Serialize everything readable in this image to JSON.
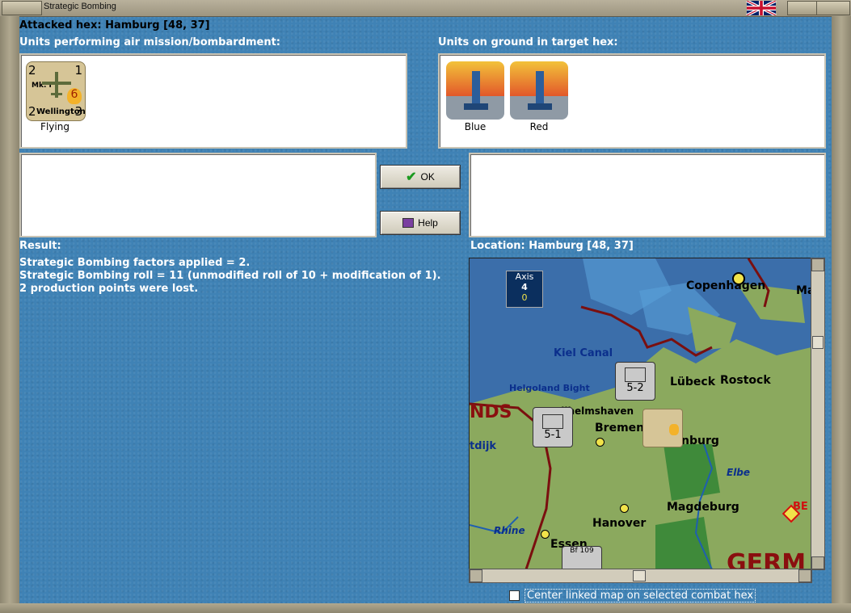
{
  "window": {
    "title": "Strategic Bombing"
  },
  "attacked_hex": "Attacked hex: Hamburg  [48, 37]",
  "air_units": {
    "heading": "Units performing air mission/bombardment:",
    "units": [
      {
        "label": "Flying",
        "counter_name": "Wellington",
        "model": "Mk. I",
        "top_left": "2",
        "top_right": "1",
        "bottom_left": "2",
        "bottom_right": "3",
        "badge": "6"
      }
    ]
  },
  "ground_units": {
    "heading": "Units on ground in target hex:",
    "units": [
      {
        "label": "Blue"
      },
      {
        "label": "Red"
      }
    ]
  },
  "buttons": {
    "ok": "OK",
    "help": "Help"
  },
  "result": {
    "heading": "Result:",
    "lines": [
      "Strategic Bombing factors applied = 2.",
      "Strategic Bombing roll = 11 (unmodified roll of 10 + modification of 1).",
      "2 production points were lost."
    ]
  },
  "location": {
    "heading": "Location:  Hamburg  [48, 37]",
    "map_labels": {
      "copenhagen": "Copenhagen",
      "ma": "Ma",
      "kiel_canal": "Kiel Canal",
      "lubeck": "Lübeck",
      "rostock": "Rostock",
      "helgoland": "Helgoland Bight",
      "wilhelmshaven": "Wilhelmshaven",
      "bremen": "Bremen",
      "hamburg": "nburg",
      "nds": "NDS",
      "tdijk": "tdijk",
      "elbe": "Elbe",
      "magdeburg": "Magdeburg",
      "hanover": "Hanover",
      "rhine": "Rhine",
      "essen": "Essen",
      "be": "BE",
      "germ": "GERM"
    },
    "axis_box": {
      "label": "Axis",
      "value1": "4",
      "value2": "0"
    },
    "unit_552": "5-2",
    "unit_551": "5-1",
    "bf109": "Bf 109"
  },
  "checkbox": {
    "label": "Center linked map on selected combat hex",
    "checked": false
  }
}
